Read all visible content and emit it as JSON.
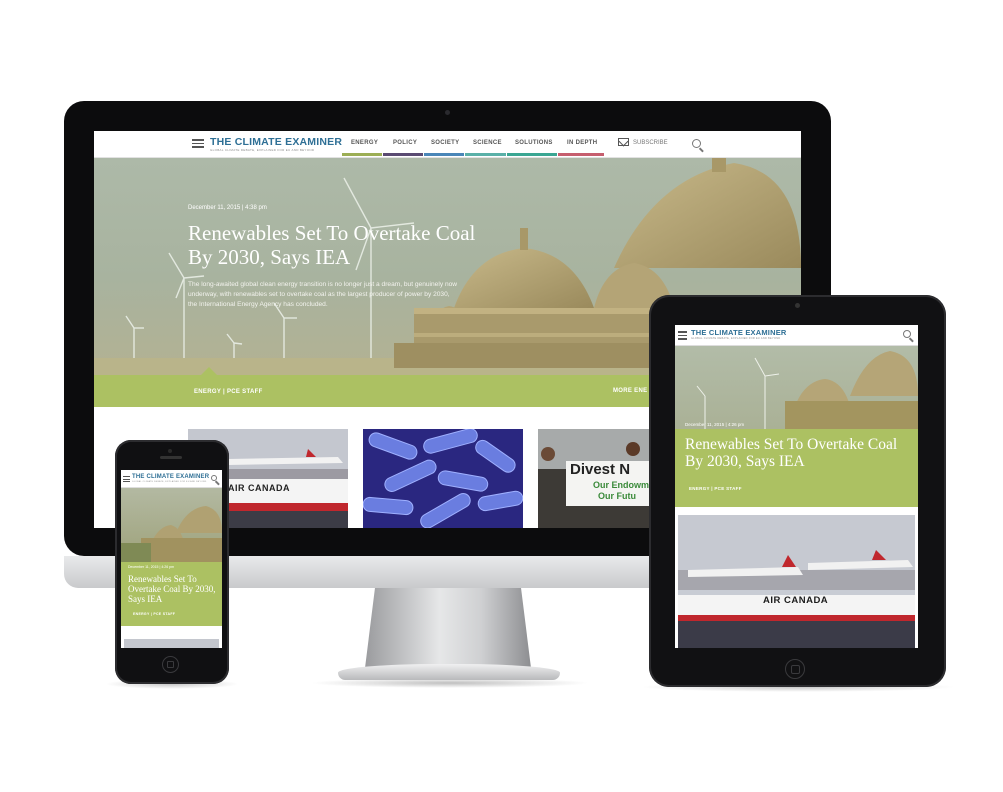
{
  "site": {
    "logo": "THE CLIMATE EXAMINER",
    "tagline": "GLOBAL CLIMATE DEBATE, EXPLAINED FOR EU AND BEYOND",
    "nav": [
      {
        "label": "ENERGY",
        "color": "#9cae55"
      },
      {
        "label": "POLICY",
        "color": "#5a4a72"
      },
      {
        "label": "SOCIETY",
        "color": "#4a86b8"
      },
      {
        "label": "SCIENCE",
        "color": "#5ab0a8"
      },
      {
        "label": "SOLUTIONS",
        "color": "#3aa693"
      },
      {
        "label": "IN DEPTH",
        "color": "#c65e6e"
      }
    ],
    "subscribe_label": "SUBSCRIBE"
  },
  "article": {
    "date": "December 11, 2015 | 4:38 pm",
    "title": "Renewables Set To Overtake Coal By 2030, Says IEA",
    "description": "The long-awaited global clean energy transition is no longer just a dream, but genuinely now underway, with renewables set to overtake coal as the largest producer of power by 2030, the International Energy Agency has concluded.",
    "category_byline": "ENERGY | PCE STAFF",
    "more_link": "MORE ENE"
  },
  "tablet": {
    "date": "December 11, 2015 | 4:26 pm",
    "title": "Renewables Set To Overtake Coal By 2030, Says IEA",
    "byline": "ENERGY | PCE STAFF",
    "plane_text": "AIR CANADA"
  },
  "phone": {
    "date": "December 11, 2015 | 4:26 pm",
    "title": "Renewables Set To Overtake Coal By 2030, Says IEA",
    "byline": "ENERGY | PCE STAFF"
  },
  "thumbnails": {
    "plane_text": "AIR CANADA",
    "protest_sign": "Divest N",
    "protest_sub1": "Our Endowm",
    "protest_sub2": "Our Futu"
  },
  "colors": {
    "accent_green": "#acc162",
    "logo_blue": "#2e6f95"
  }
}
